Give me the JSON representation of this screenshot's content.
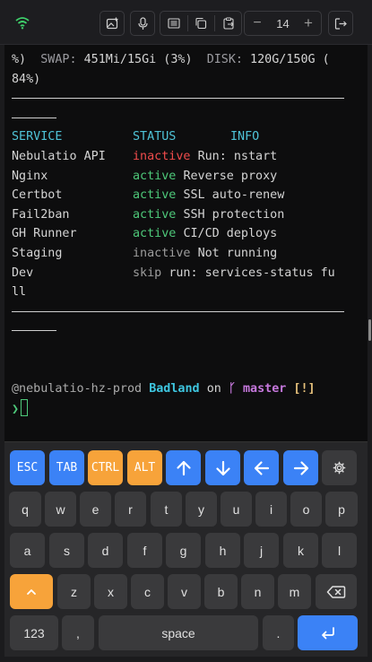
{
  "toolbar": {
    "wifi_icon": "wifi-icon",
    "font_size": "14",
    "decrease_label": "−",
    "increase_label": "+",
    "icons": [
      "image-plus-icon",
      "microphone-icon",
      "keyboard-layout-icon",
      "copy-icon",
      "paste-icon",
      "logout-icon"
    ]
  },
  "terminal": {
    "line1_a": "%)  ",
    "line1_swap_label": "SWAP:",
    "line1_swap_value": " 451Mi/15Gi (3%)  ",
    "line1_disk_label": "DISK:",
    "line1_disk_value": " 120G/150G (",
    "line2": "84%)",
    "headers": {
      "service": "SERVICE",
      "status": "STATUS",
      "info": "INFO"
    },
    "services": [
      {
        "name": "Nebulatio API",
        "status": "inactive",
        "info": "Run: nstart"
      },
      {
        "name": "Nginx",
        "status": "active",
        "info": "Reverse proxy"
      },
      {
        "name": "Certbot",
        "status": "active",
        "info": "SSL auto-renew"
      },
      {
        "name": "Fail2ban",
        "status": "active",
        "info": "SSH protection"
      },
      {
        "name": "GH Runner",
        "status": "active",
        "info": "CI/CD deploys"
      },
      {
        "name": "Staging",
        "status": "inactive",
        "info": "Not running"
      },
      {
        "name": "Dev",
        "status": "skip",
        "info": "run: services-status fu"
      }
    ],
    "dev_wrap": "ll",
    "prompt": {
      "user_host": "@nebulatio-hz-prod",
      "dir": "Badland",
      "on": "on",
      "branch_icon": "ᚴ",
      "branch": "master",
      "flags": "[!]",
      "symbol": "❯"
    }
  },
  "keyboard": {
    "row1": [
      {
        "label": "ESC",
        "style": "blue"
      },
      {
        "label": "TAB",
        "style": "blue"
      },
      {
        "label": "CTRL",
        "style": "orange"
      },
      {
        "label": "ALT",
        "style": "orange"
      },
      {
        "icon": "arrow-up-icon",
        "style": "blue"
      },
      {
        "icon": "arrow-down-icon",
        "style": "blue"
      },
      {
        "icon": "arrow-left-icon",
        "style": "blue"
      },
      {
        "icon": "arrow-right-icon",
        "style": "blue"
      },
      {
        "icon": "gear-icon",
        "style": "gray"
      }
    ],
    "row2": [
      "q",
      "w",
      "e",
      "r",
      "t",
      "y",
      "u",
      "i",
      "o",
      "p"
    ],
    "row3": [
      "a",
      "s",
      "d",
      "f",
      "g",
      "h",
      "j",
      "k",
      "l"
    ],
    "row4": [
      "z",
      "x",
      "c",
      "v",
      "b",
      "n",
      "m"
    ],
    "shift_icon": "shift-caret-icon",
    "backspace_icon": "backspace-icon",
    "numbers_label": "123",
    "comma_label": ",",
    "space_label": "space",
    "period_label": ".",
    "enter_icon": "enter-icon",
    "colors": {
      "blue": "#3b82f6",
      "orange": "#f7a33a",
      "key": "#3a3a3c"
    }
  }
}
